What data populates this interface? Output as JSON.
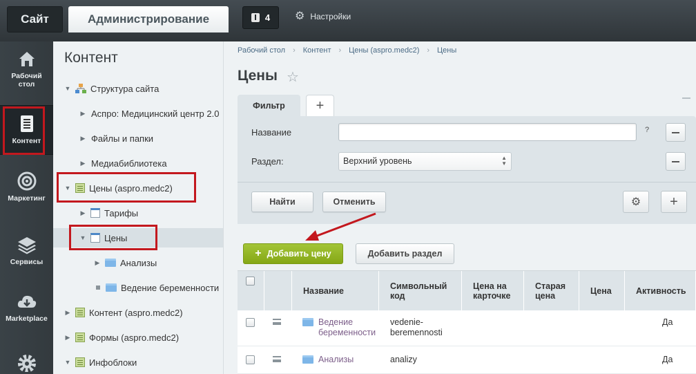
{
  "top": {
    "site_tab": "Сайт",
    "admin_tab": "Администрирование",
    "notifications_count": "4",
    "settings_label": "Настройки"
  },
  "nav": {
    "items": [
      {
        "label1": "Рабочий",
        "label2": "стол"
      },
      {
        "label1": "Контент",
        "label2": ""
      },
      {
        "label1": "Маркетинг",
        "label2": ""
      },
      {
        "label1": "Сервисы",
        "label2": ""
      },
      {
        "label1": "Marketplace",
        "label2": ""
      }
    ]
  },
  "tree": {
    "title": "Контент",
    "items": [
      {
        "label": "Структура сайта"
      },
      {
        "label": "Аспро: Медицинский центр 2.0"
      },
      {
        "label": "Файлы и папки"
      },
      {
        "label": "Медиабиблиотека"
      },
      {
        "label": "Цены (aspro.medc2)"
      },
      {
        "label": "Тарифы"
      },
      {
        "label": "Цены"
      },
      {
        "label": "Анализы"
      },
      {
        "label": "Ведение беременности"
      },
      {
        "label": "Контент (aspro.medc2)"
      },
      {
        "label": "Формы (aspro.medc2)"
      },
      {
        "label": "Инфоблоки"
      }
    ]
  },
  "breadcrumb": [
    "Рабочий стол",
    "Контент",
    "Цены (aspro.medc2)",
    "Цены"
  ],
  "page": {
    "title": "Цены"
  },
  "filter": {
    "tab_label": "Фильтр",
    "add_tab": "+",
    "name_label": "Название",
    "name_value": "",
    "section_label": "Раздел:",
    "section_value": "Верхний уровень",
    "help": "?",
    "find_button": "Найти",
    "cancel_button": "Отменить"
  },
  "toolbar": {
    "add_price": "Добавить цену",
    "add_section": "Добавить раздел"
  },
  "table": {
    "columns": [
      "Название",
      "Символьный код",
      "Цена на карточке",
      "Старая цена",
      "Цена",
      "Активность"
    ],
    "col_code_1": "Символьный",
    "col_code_2": "код",
    "col_card_1": "Цена на",
    "col_card_2": "карточке",
    "col_old_1": "Старая",
    "col_old_2": "цена",
    "rows": [
      {
        "name1": "Ведение",
        "name2": "беременности",
        "code1": "vedenie-",
        "code2": "beremennosti",
        "active": "Да"
      },
      {
        "name1": "Анализы",
        "name2": "",
        "code1": "analizy",
        "code2": "",
        "active": "Да"
      }
    ]
  },
  "colors": {
    "accent_green": "#94b62a",
    "highlight_red": "#c3181e"
  }
}
